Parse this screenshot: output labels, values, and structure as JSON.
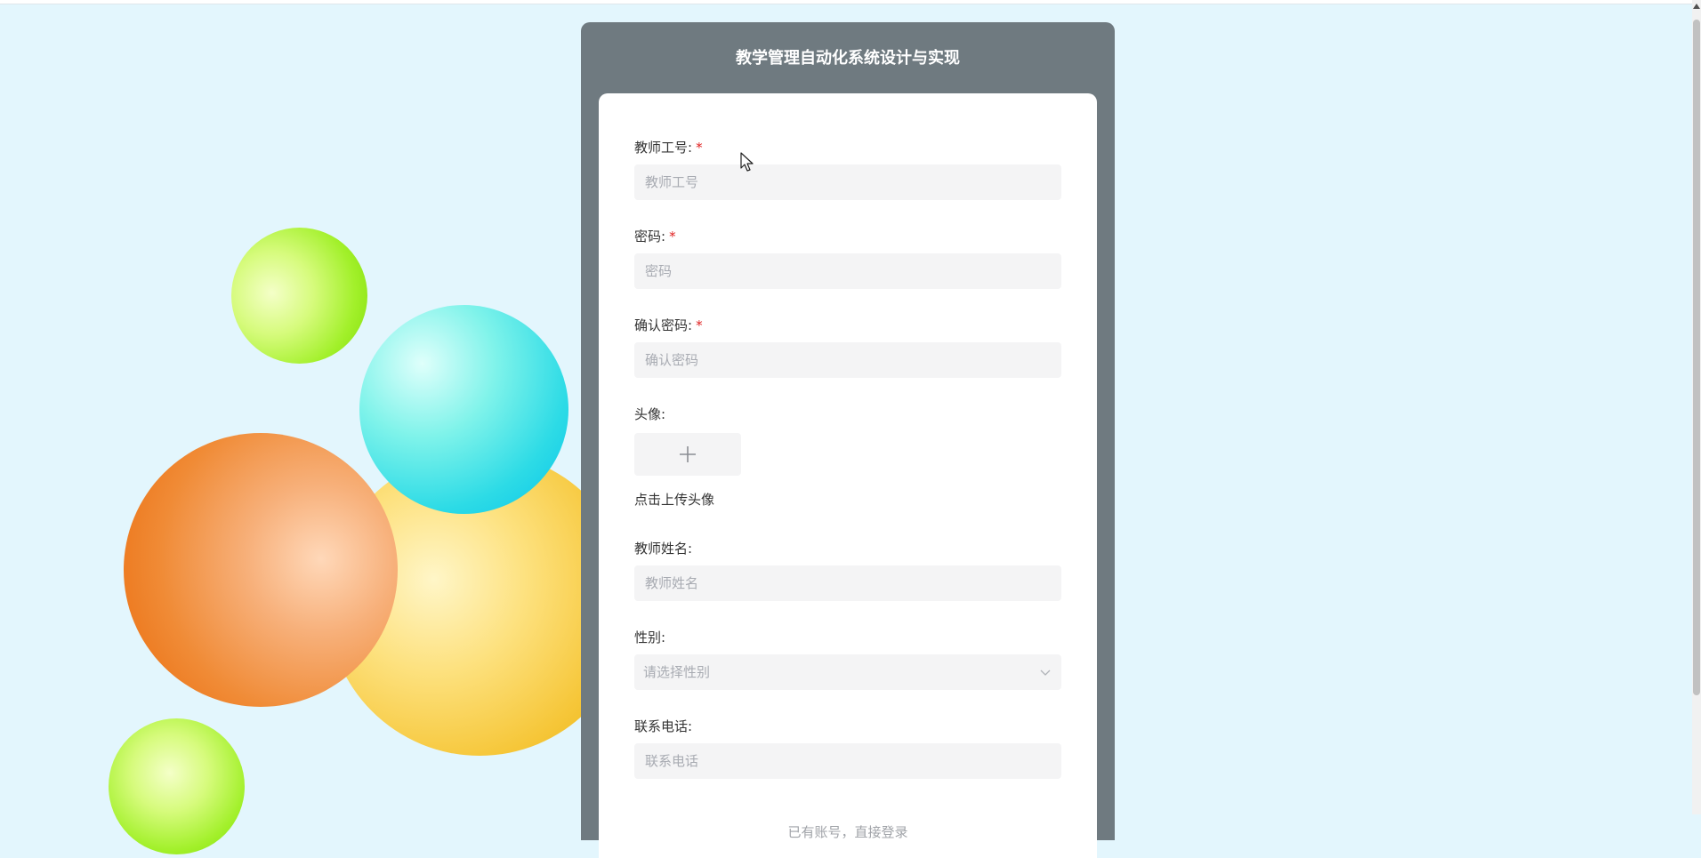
{
  "colors": {
    "page_bg": "#e3f6fd",
    "panel_bg": "#6f7a80",
    "required": "#e02020",
    "input_bg": "#f4f4f5"
  },
  "form": {
    "title": "教学管理自动化系统设计与实现",
    "fields": {
      "teacher_id": {
        "label": "教师工号:",
        "required_mark": "*",
        "placeholder": "教师工号"
      },
      "password": {
        "label": "密码:",
        "required_mark": "*",
        "placeholder": "密码"
      },
      "confirm_password": {
        "label": "确认密码:",
        "required_mark": "*",
        "placeholder": "确认密码"
      },
      "avatar": {
        "label": "头像:",
        "upload_icon": "plus-icon",
        "hint": "点击上传头像"
      },
      "teacher_name": {
        "label": "教师姓名:",
        "placeholder": "教师姓名"
      },
      "gender": {
        "label": "性别:",
        "placeholder": "请选择性别",
        "icon": "chevron-down-icon"
      },
      "phone": {
        "label": "联系电话:",
        "placeholder": "联系电话"
      }
    },
    "login_link": "已有账号，直接登录"
  }
}
